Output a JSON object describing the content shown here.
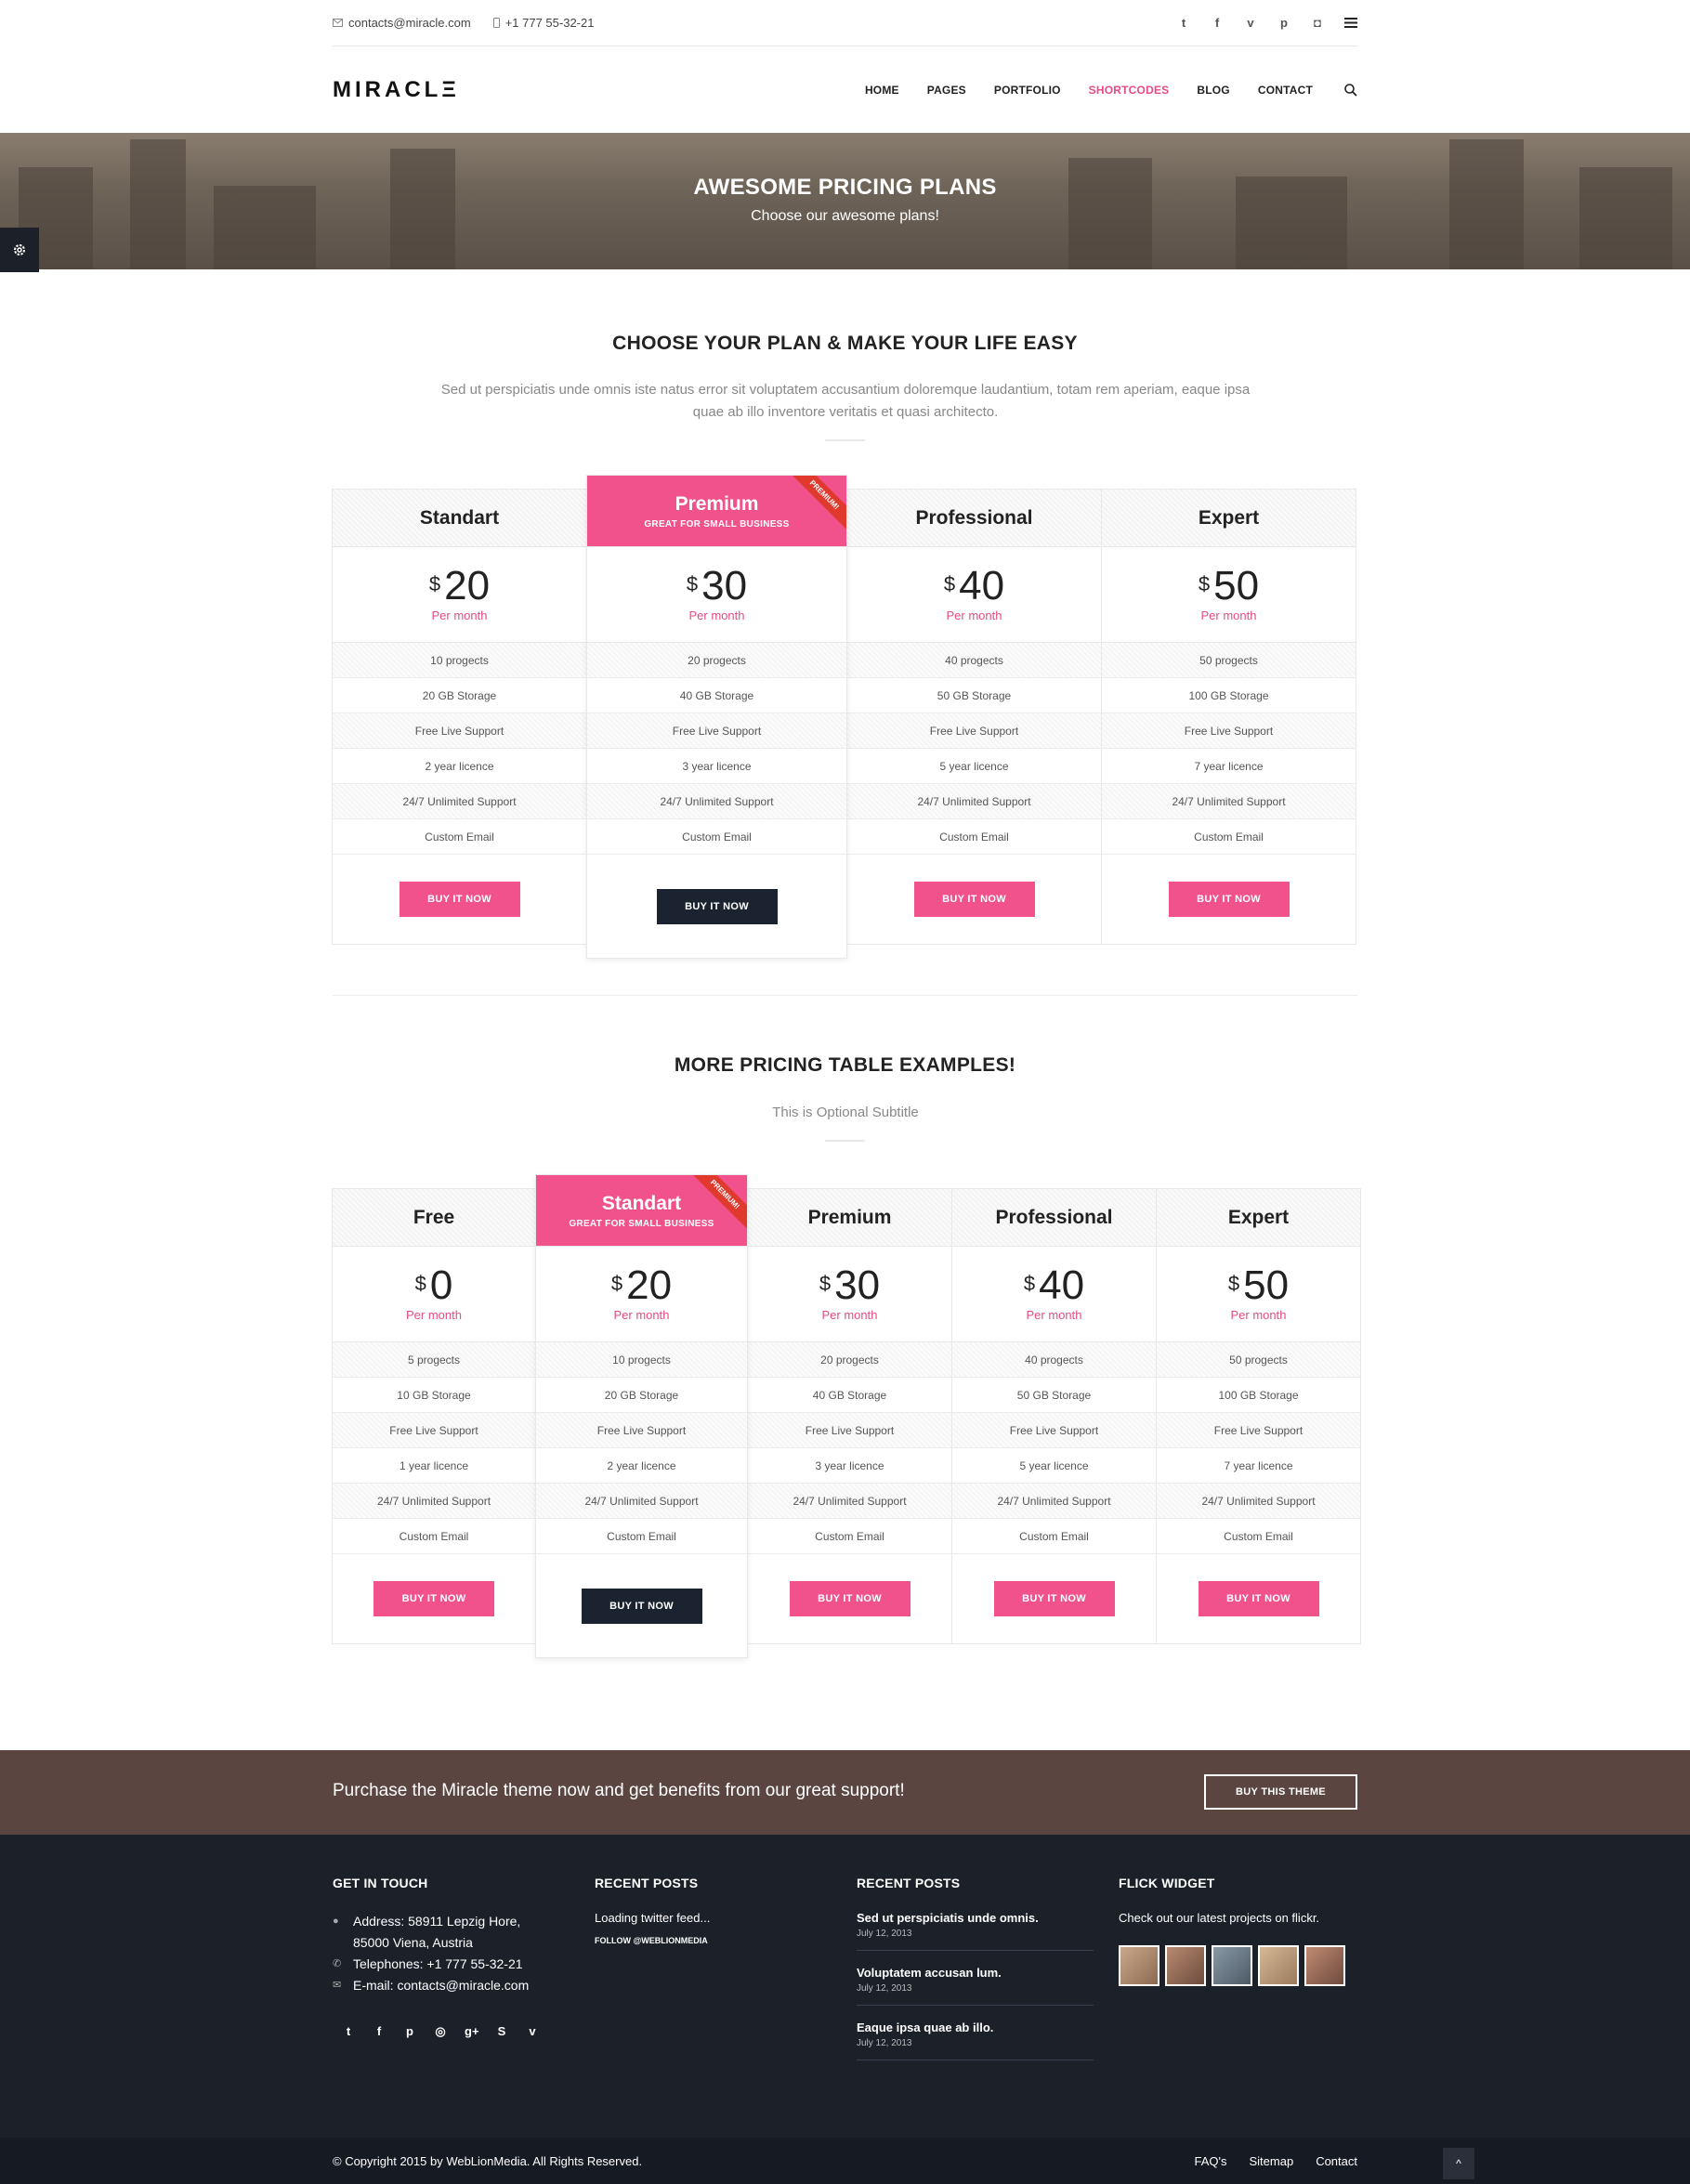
{
  "topbar": {
    "email": "contacts@miracle.com",
    "phone": "+1 777 55-32-21",
    "social": [
      "twitter-icon",
      "facebook-icon",
      "vimeo-icon",
      "pinterest-icon",
      "instagram-icon"
    ],
    "social_glyphs": [
      "t",
      "f",
      "v",
      "p",
      "◘"
    ]
  },
  "header": {
    "logo": "MIRACLΞ",
    "nav": [
      "HOME",
      "PAGES",
      "PORTFOLIO",
      "SHORTCODES",
      "BLOG",
      "CONTACT"
    ],
    "active": "SHORTCODES"
  },
  "hero": {
    "title": "AWESOME PRICING PLANS",
    "subtitle": "Choose our awesome plans!"
  },
  "section1": {
    "title": "CHOOSE YOUR PLAN & MAKE YOUR LIFE EASY",
    "text": "Sed ut perspiciatis unde omnis iste natus error sit voluptatem accusantium doloremque laudantium, totam rem aperiam, eaque ipsa quae ab illo inventore veritatis et quasi architecto."
  },
  "table1": [
    {
      "name": "Standart",
      "currency": "$",
      "price": "20",
      "per": "Per month",
      "features": [
        "10 progects",
        "20 GB Storage",
        "Free Live Support",
        "2 year licence",
        "24/7 Unlimited Support",
        "Custom Email"
      ],
      "button": "BUY IT NOW"
    },
    {
      "name": "Premium",
      "sub": "GREAT FOR SMALL BUSINESS",
      "ribbon": "PREMIUM!",
      "featured": true,
      "currency": "$",
      "price": "30",
      "per": "Per month",
      "features": [
        "20 progects",
        "40 GB Storage",
        "Free Live Support",
        "3 year licence",
        "24/7 Unlimited Support",
        "Custom Email"
      ],
      "button": "BUY IT NOW"
    },
    {
      "name": "Professional",
      "currency": "$",
      "price": "40",
      "per": "Per month",
      "features": [
        "40 progects",
        "50 GB Storage",
        "Free Live Support",
        "5 year licence",
        "24/7 Unlimited Support",
        "Custom Email"
      ],
      "button": "BUY IT NOW"
    },
    {
      "name": "Expert",
      "currency": "$",
      "price": "50",
      "per": "Per month",
      "features": [
        "50 progects",
        "100 GB Storage",
        "Free Live Support",
        "7 year licence",
        "24/7 Unlimited Support",
        "Custom Email"
      ],
      "button": "BUY IT NOW"
    }
  ],
  "section2": {
    "title": "MORE PRICING TABLE EXAMPLES!",
    "subtitle": "This is Optional Subtitle"
  },
  "table2": [
    {
      "name": "Free",
      "currency": "$",
      "price": "0",
      "per": "Per month",
      "features": [
        "5 progects",
        "10 GB Storage",
        "Free Live Support",
        "1 year licence",
        "24/7 Unlimited Support",
        "Custom Email"
      ],
      "button": "BUY IT NOW"
    },
    {
      "name": "Standart",
      "sub": "GREAT FOR SMALL BUSINESS",
      "ribbon": "PREMIUM!",
      "featured": true,
      "currency": "$",
      "price": "20",
      "per": "Per month",
      "features": [
        "10 progects",
        "20 GB Storage",
        "Free Live Support",
        "2 year licence",
        "24/7 Unlimited Support",
        "Custom Email"
      ],
      "button": "BUY IT NOW"
    },
    {
      "name": "Premium",
      "currency": "$",
      "price": "30",
      "per": "Per month",
      "features": [
        "20 progects",
        "40 GB Storage",
        "Free Live Support",
        "3 year licence",
        "24/7 Unlimited Support",
        "Custom Email"
      ],
      "button": "BUY IT NOW"
    },
    {
      "name": "Professional",
      "currency": "$",
      "price": "40",
      "per": "Per month",
      "features": [
        "40 progects",
        "50 GB Storage",
        "Free Live Support",
        "5 year licence",
        "24/7 Unlimited Support",
        "Custom Email"
      ],
      "button": "BUY IT NOW"
    },
    {
      "name": "Expert",
      "currency": "$",
      "price": "50",
      "per": "Per month",
      "features": [
        "50 progects",
        "100 GB Storage",
        "Free Live Support",
        "7 year licence",
        "24/7 Unlimited Support",
        "Custom Email"
      ],
      "button": "BUY IT NOW"
    }
  ],
  "cta": {
    "text": "Purchase the Miracle theme now and get benefits from our great support!",
    "button": "BUY THIS THEME"
  },
  "footer": {
    "contact": {
      "title": "GET IN TOUCH",
      "address1": "Address: 58911 Lepzig Hore,",
      "address2": "85000 Viena, Austria",
      "phone": "Telephones: +1 777 55-32-21",
      "email": "E-mail: contacts@miracle.com",
      "social_glyphs": [
        "t",
        "f",
        "p",
        "◎",
        "g+",
        "S",
        "v"
      ]
    },
    "twitter": {
      "title": "RECENT POSTS",
      "loading": "Loading twitter feed...",
      "follow": "FOLLOW @WEBLIONMEDIA"
    },
    "posts": {
      "title": "RECENT POSTS",
      "items": [
        {
          "title": "Sed ut perspiciatis unde omnis.",
          "date": "July 12, 2013"
        },
        {
          "title": "Voluptatem accusan lum.",
          "date": "July 12, 2013"
        },
        {
          "title": "Eaque ipsa quae ab illo.",
          "date": "July 12, 2013"
        }
      ]
    },
    "flickr": {
      "title": "FLICK WIDGET",
      "text": "Check out our latest projects on flickr."
    }
  },
  "bottom": {
    "copyright": "© Copyright 2015 by WebLionMedia. All Rights Reserved.",
    "links": [
      "FAQ's",
      "Sitemap",
      "Contact"
    ]
  },
  "colors": {
    "accent": "#f2528b",
    "dark": "#1b2029",
    "cta": "#5a4540"
  }
}
